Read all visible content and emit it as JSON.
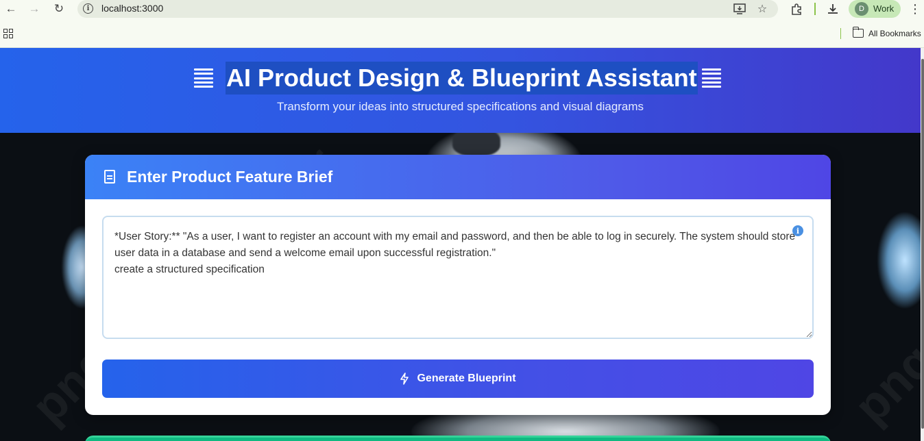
{
  "browser": {
    "url": "localhost:3000",
    "profile_initial": "D",
    "profile_label": "Work",
    "bookmarks_label": "All Bookmarks"
  },
  "hero": {
    "title": "AI Product Design & Blueprint Assistant",
    "subtitle": "Transform your ideas into structured specifications and visual diagrams"
  },
  "card": {
    "title": "Enter Product Feature Brief",
    "brief_value": "*User Story:** \"As a user, I want to register an account with my email and password, and then be able to log in securely. The system should store user data in a database and send a welcome email upon successful registration.\"\ncreate a structured specification",
    "generate_label": "Generate Blueprint"
  },
  "colors": {
    "hero_start": "#2563eb",
    "hero_end": "#4338ca",
    "button_start": "#2563eb",
    "button_end": "#4f46e5",
    "info_icon": "#4a90e2",
    "next_card_accent": "#10b981"
  }
}
